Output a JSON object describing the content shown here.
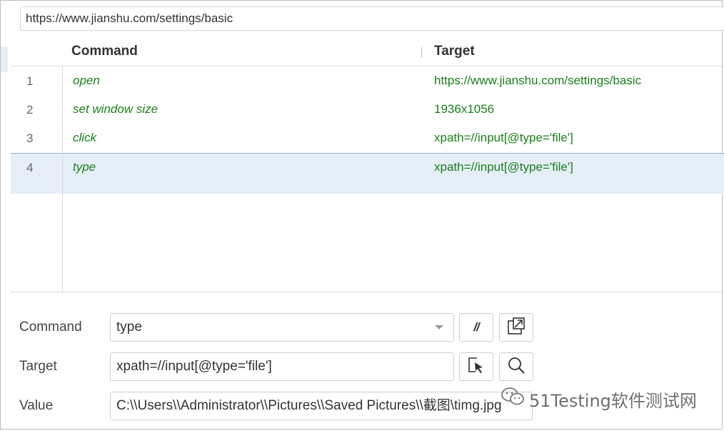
{
  "url_bar": {
    "value": "https://www.jianshu.com/settings/basic"
  },
  "table": {
    "headers": {
      "command": "Command",
      "target": "Target"
    },
    "rows": [
      {
        "num": "1",
        "command": "open",
        "target": "https://www.jianshu.com/settings/basic"
      },
      {
        "num": "2",
        "command": "set window size",
        "target": "1936x1056"
      },
      {
        "num": "3",
        "command": "click",
        "target": "xpath=//input[@type='file']"
      },
      {
        "num": "4",
        "command": "type",
        "target": "xpath=//input[@type='file']"
      }
    ],
    "selected_row": 4
  },
  "form": {
    "command": {
      "label": "Command",
      "value": "type",
      "comment_button": "//"
    },
    "target": {
      "label": "Target",
      "value": "xpath=//input[@type='file']"
    },
    "value": {
      "label": "Value",
      "value": "C:\\\\Users\\\\Administrator\\\\Pictures\\\\Saved Pictures\\\\截图\\timg.jpg"
    }
  },
  "watermark": {
    "text": "51Testing软件测试网"
  },
  "icons": {
    "open_reference": "external-link-icon",
    "select_target": "cursor-select-icon",
    "find_target": "magnifier-icon",
    "wechat": "wechat-icon"
  },
  "colors": {
    "command_text": "#1b7f1b",
    "selected_row_bg": "#e5eef7",
    "selected_row_border": "#8fb0d3"
  }
}
